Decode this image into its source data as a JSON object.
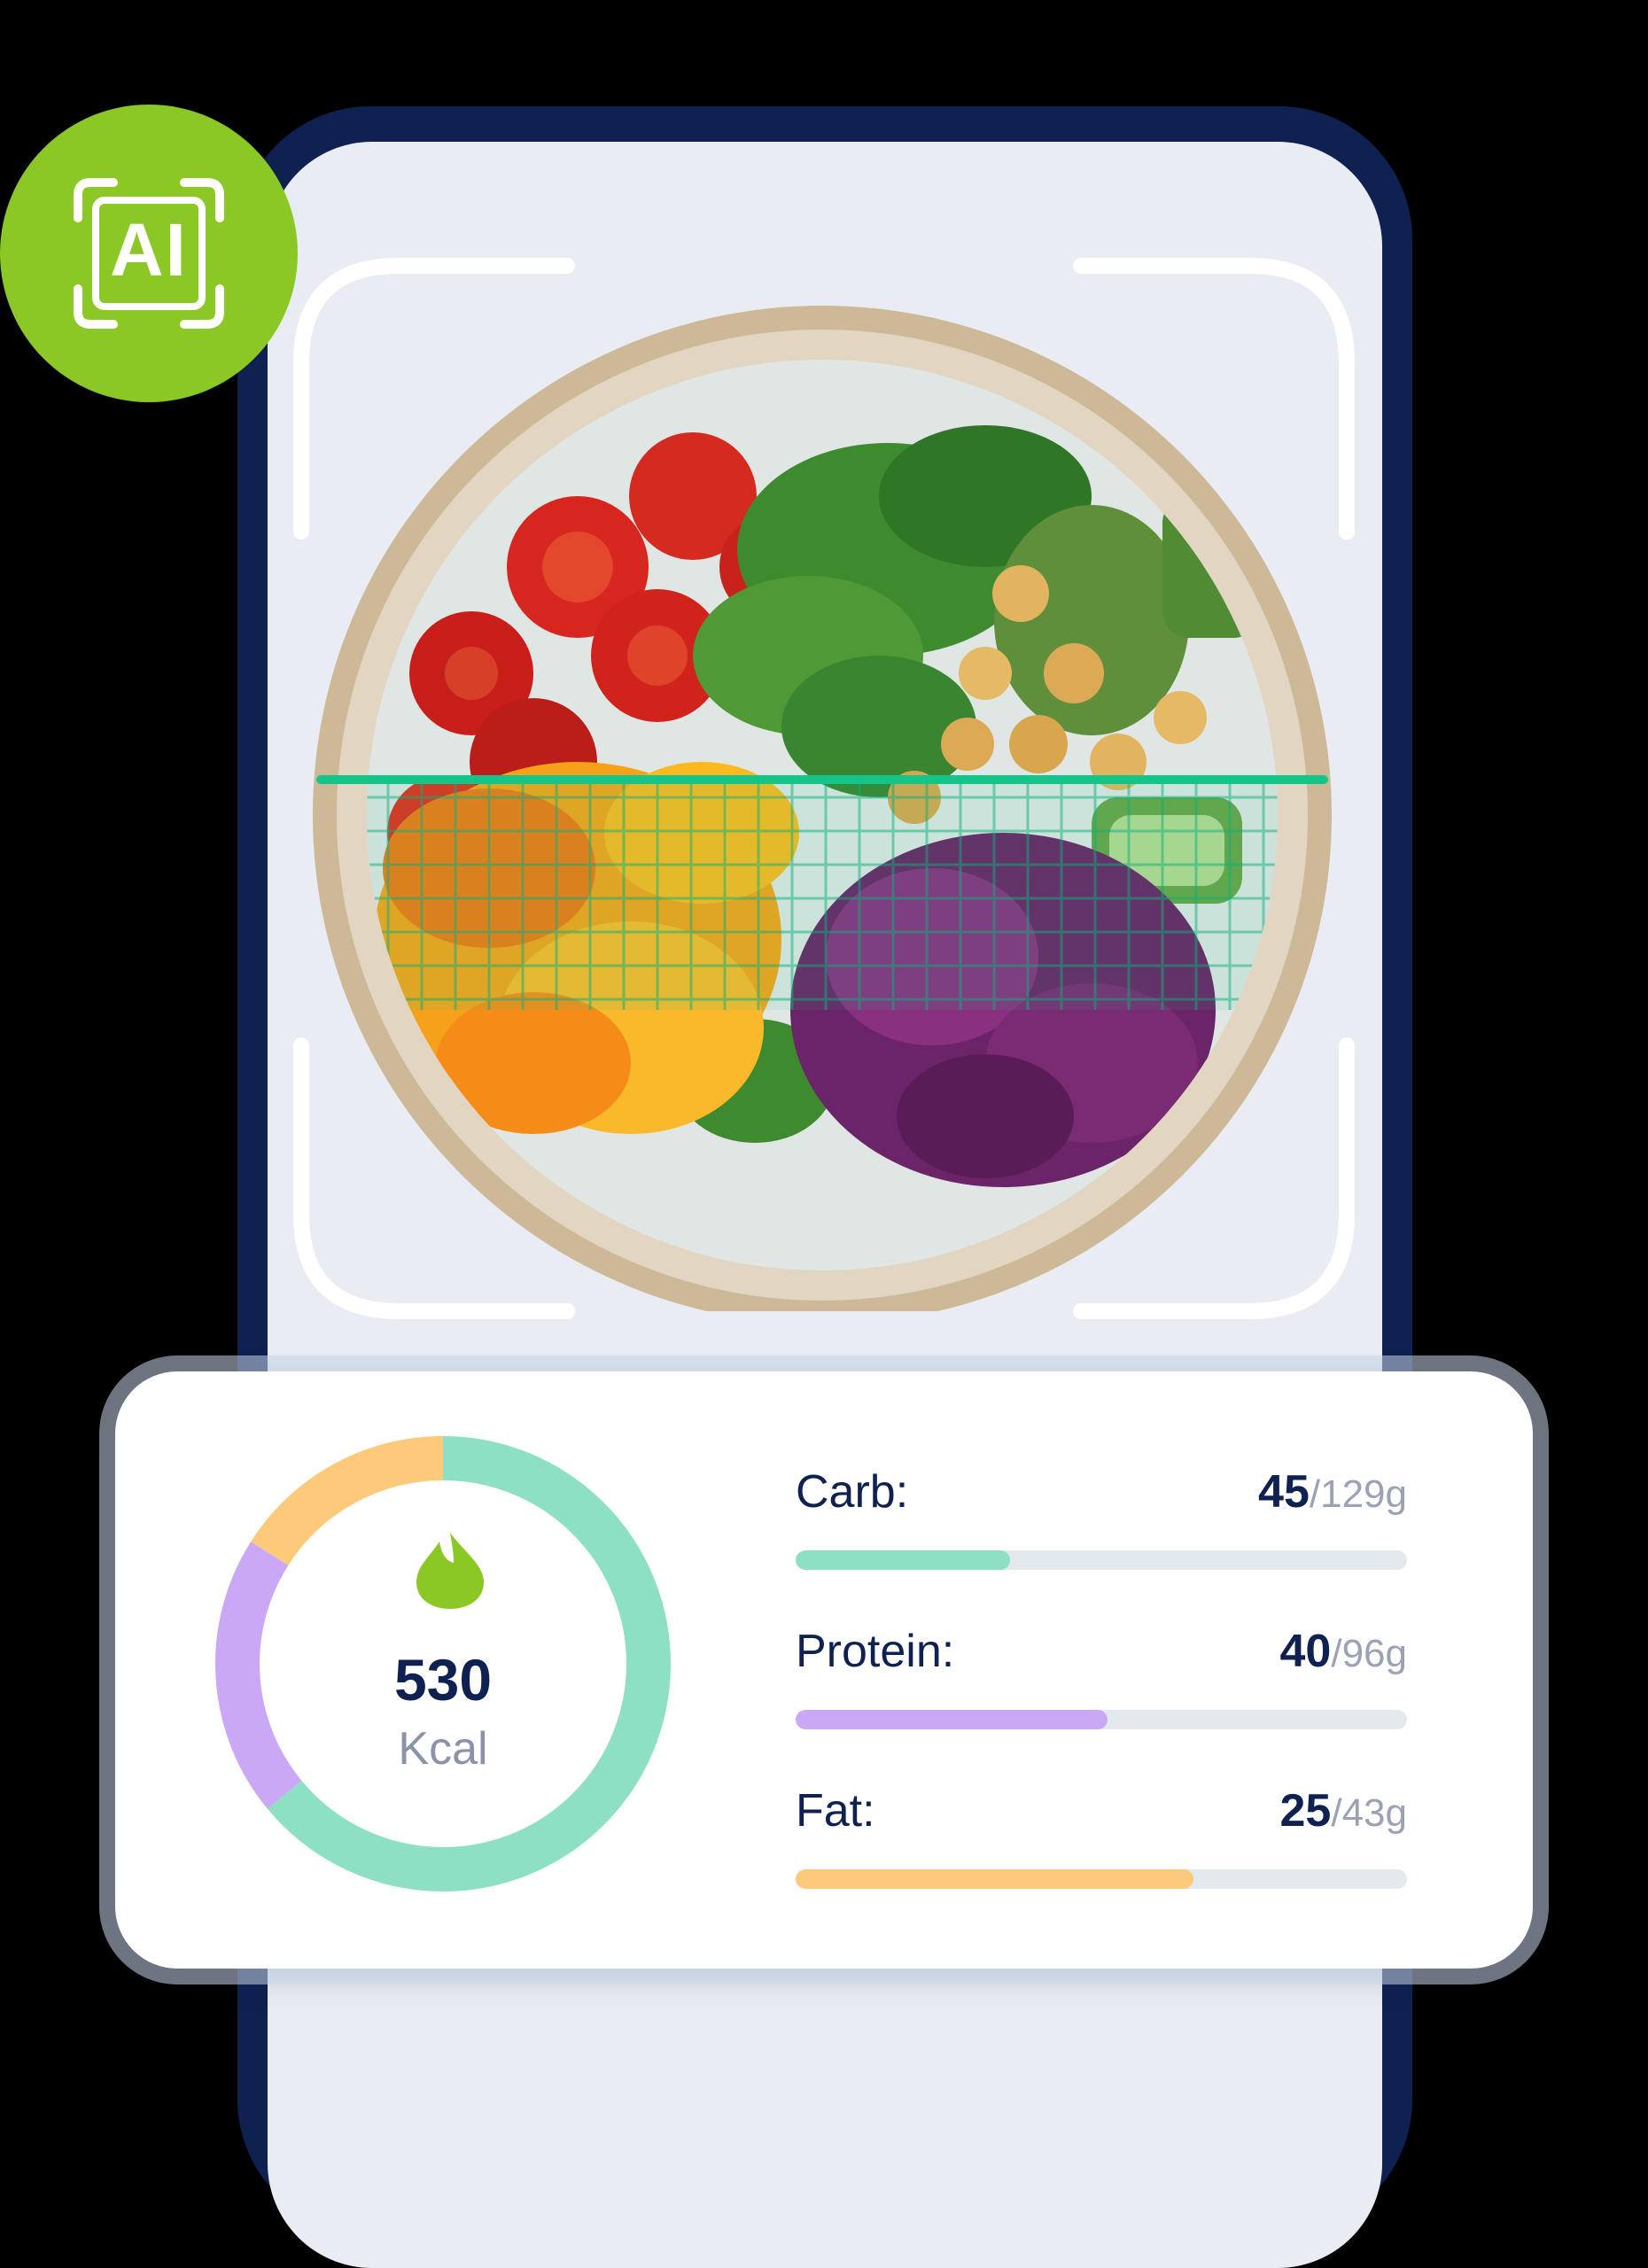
{
  "badge": {
    "text": "AI"
  },
  "colors": {
    "carb": "#8ee0c4",
    "protein": "#cba8f5",
    "fat": "#fdc97a",
    "brand_green": "#8bc826",
    "navy": "#0f2150"
  },
  "summary": {
    "calories": "530",
    "unit": "Kcal",
    "icon": "flame-icon"
  },
  "macros": [
    {
      "name": "carb",
      "label": "Carb:",
      "current": "45",
      "total": "/129g",
      "fraction": 0.35
    },
    {
      "name": "protein",
      "label": "Protein:",
      "current": "40",
      "total": "/96g",
      "fraction": 0.51
    },
    {
      "name": "fat",
      "label": "Fat:",
      "current": "25",
      "total": "/43g",
      "fraction": 0.65
    }
  ],
  "ring_segments": [
    {
      "name": "carb",
      "color": "#8ee0c4",
      "fraction": 0.64
    },
    {
      "name": "protein",
      "color": "#cba8f5",
      "fraction": 0.2
    },
    {
      "name": "fat",
      "color": "#fdc97a",
      "fraction": 0.16
    }
  ]
}
